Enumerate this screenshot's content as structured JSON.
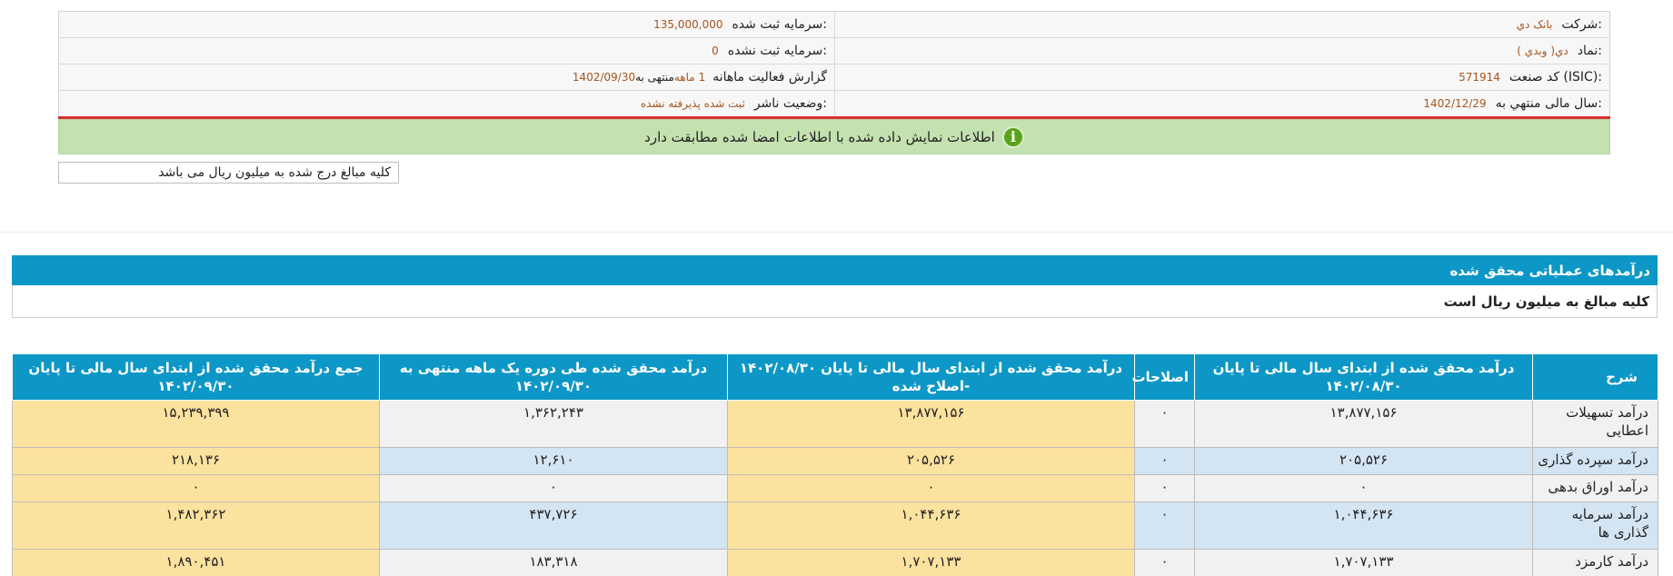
{
  "info": {
    "company_label": "شرکت:",
    "company_value": "بانک دي",
    "symbol_label": "نماد:",
    "symbol_value": "دي( وبدي )",
    "isic_label": "کد صنعت (ISIC):",
    "isic_value": "571914",
    "fiscal_label": "سال مالی منتهي به:",
    "fiscal_value": "1402/12/29",
    "capital_label": "سرمايه ثبت شده:",
    "capital_value": "135,000,000",
    "unreg_label": "سرمايه ثبت نشده:",
    "unreg_value": "0",
    "report_label": "گزارش فعالیت ماهانه",
    "report_value": "1 ماهه",
    "report_end_label": "منتهی به",
    "report_end_value": "1402/09/30",
    "status_label": "وضعيت ناشر:",
    "status_value": "ثبت شده پذيرفته نشده"
  },
  "notice": {
    "text": "اطلاعات نمایش داده شده با اطلاعات امضا شده مطابقت دارد",
    "icon": "info-icon"
  },
  "unit_note": "کلیه مبالغ درج شده به میلیون ریال می باشد",
  "section": {
    "title": "درآمدهای عملیاتی محقق شده",
    "note": "کلیه مبالغ به میلیون ریال است"
  },
  "table": {
    "headers": [
      "شرح",
      "درآمد محقق شده از ابتدای سال مالی تا پایان ۱۴۰۲/۰۸/۳۰",
      "اصلاحات",
      "درآمد محقق شده از ابتدای سال مالی تا پایان ۱۴۰۲/۰۸/۳۰ -اصلاح شده",
      "درآمد محقق شده طی دوره یک ماهه منتهی به ۱۴۰۲/۰۹/۳۰",
      "جمع درآمد محقق شده از ابتدای سال مالی تا پایان ۱۴۰۲/۰۹/۳۰"
    ],
    "rows": [
      [
        "درآمد تسهیلات اعطایی",
        "۱۳,۸۷۷,۱۵۶",
        "۰",
        "۱۳,۸۷۷,۱۵۶",
        "۱,۳۶۲,۲۴۳",
        "۱۵,۲۳۹,۳۹۹"
      ],
      [
        "درآمد سپرده گذاری",
        "۲۰۵,۵۲۶",
        "۰",
        "۲۰۵,۵۲۶",
        "۱۲,۶۱۰",
        "۲۱۸,۱۳۶"
      ],
      [
        "درآمد اوراق بدهی",
        "۰",
        "۰",
        "۰",
        "۰",
        "۰"
      ],
      [
        "درآمد سرمایه گذاری ها",
        "۱,۰۴۴,۶۳۶",
        "۰",
        "۱,۰۴۴,۶۳۶",
        "۴۳۷,۷۲۶",
        "۱,۴۸۲,۳۶۲"
      ],
      [
        "درآمد کارمزد",
        "۱,۷۰۷,۱۳۳",
        "۰",
        "۱,۷۰۷,۱۳۳",
        "۱۸۳,۳۱۸",
        "۱,۸۹۰,۴۵۱"
      ]
    ]
  },
  "colors": {
    "header_blue": "#0d97c6",
    "value_brown": "#a5551d",
    "notice_green": "#c4e1b0",
    "highlight_yellow": "#fce29f",
    "row_blue": "#d3e4f2",
    "row_grey": "#f1f1f1",
    "alert_red": "#d9302c"
  }
}
